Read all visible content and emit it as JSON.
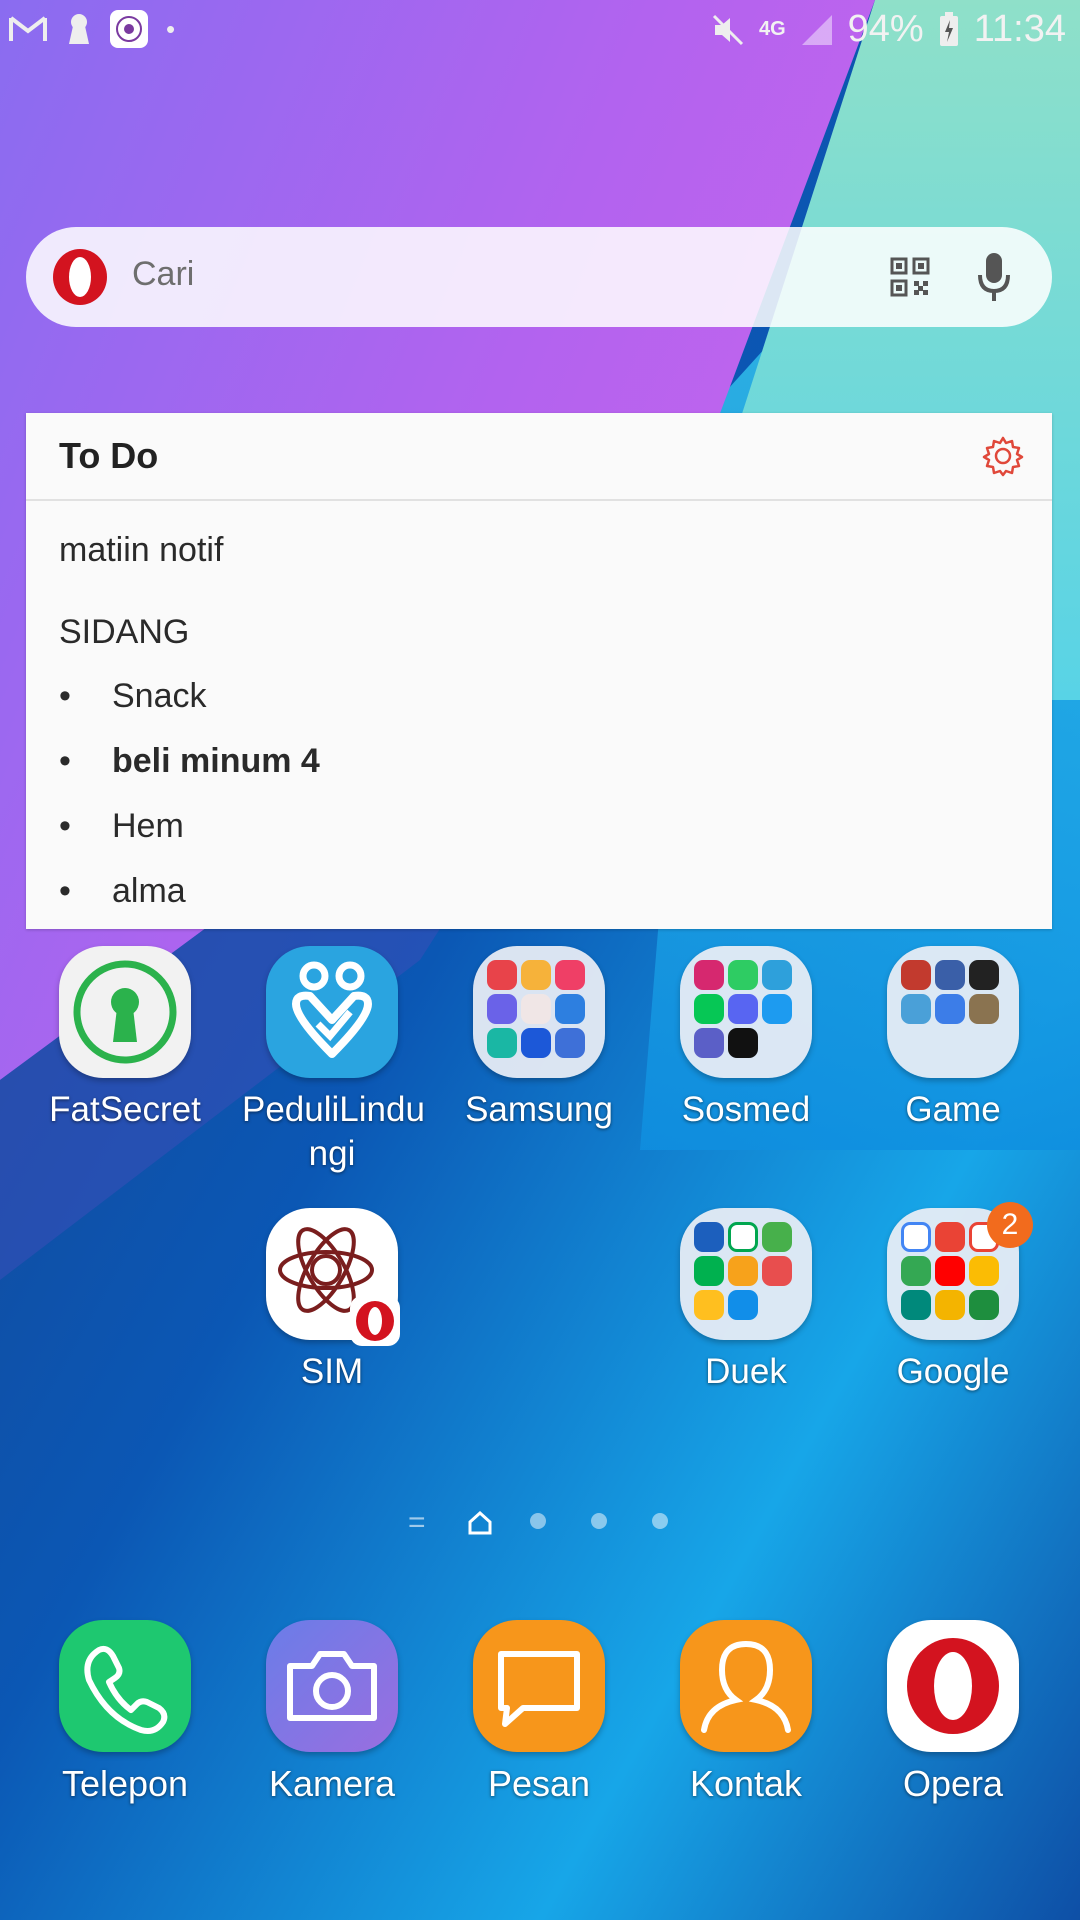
{
  "status_bar": {
    "network": "4G",
    "battery": "94%",
    "time": "11:34"
  },
  "search": {
    "placeholder": "Cari"
  },
  "todo_widget": {
    "title": "To Do",
    "items": [
      {
        "text": "matiin notif"
      },
      {
        "text": "SIDANG"
      }
    ],
    "bullets": [
      {
        "text": "Snack"
      },
      {
        "text": "beli minum 4"
      },
      {
        "text": "Hem"
      },
      {
        "text": "alma"
      }
    ]
  },
  "apps": {
    "fatsecret": "FatSecret",
    "pedulilindungi_line1": "PeduliLindu",
    "pedulilindungi_line2": "ngi",
    "samsung": "Samsung",
    "sosmed": "Sosmed",
    "game": "Game",
    "sim": "SIM",
    "duek": "Duek",
    "google": "Google",
    "google_badge": "2"
  },
  "dock": {
    "telepon": "Telepon",
    "kamera": "Kamera",
    "pesan": "Pesan",
    "kontak": "Kontak",
    "opera": "Opera"
  },
  "colors": {
    "opera_red": "#d3131f",
    "phone_green": "#1ec870",
    "message_orange": "#f7a21b",
    "badge_orange": "#f26b1d"
  }
}
